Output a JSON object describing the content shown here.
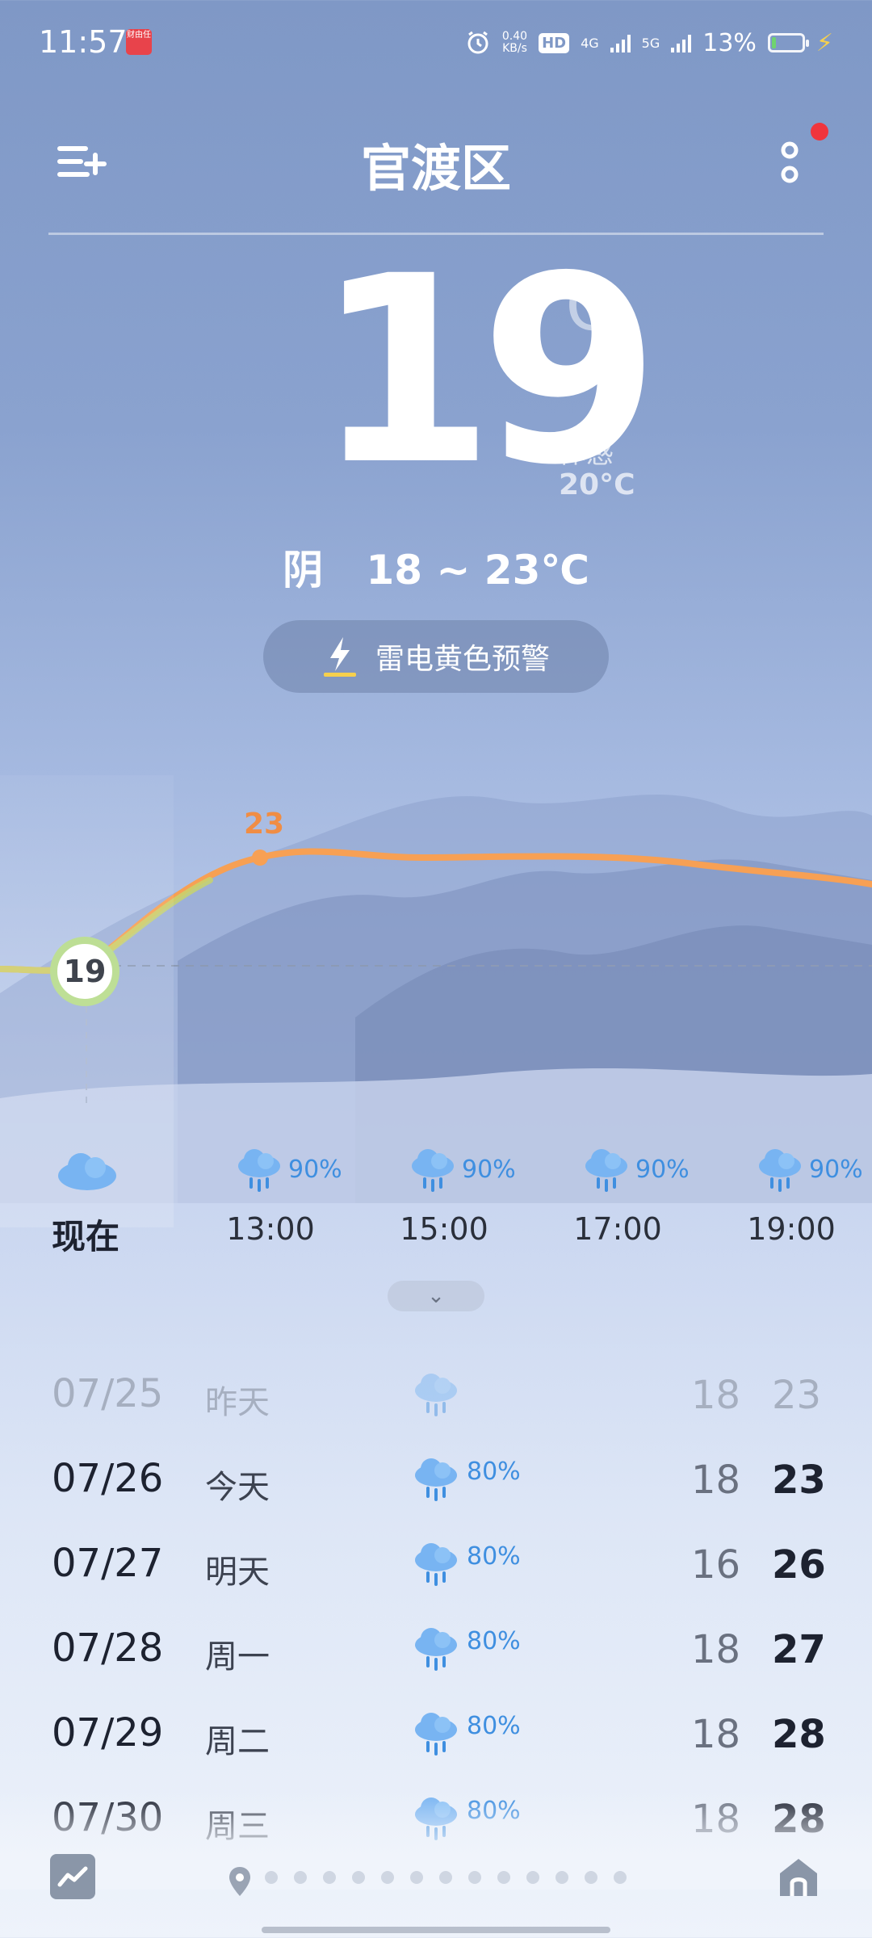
{
  "status_bar": {
    "time": "11:57",
    "app_badge": "财由任",
    "net_speed_value": "0.40",
    "net_speed_unit": "KB/s",
    "hd": "HD",
    "network_4g": "4G",
    "network_5g": "5G",
    "battery_percent": "13%",
    "battery_level": 0.13
  },
  "header": {
    "city": "官渡区",
    "menu_icon": "menu-add-icon",
    "more_icon": "more-icon"
  },
  "current": {
    "temperature": "19",
    "unit": "℃",
    "feels_like_label": "体感",
    "feels_like_value": "20°C",
    "condition": "阴",
    "range": "18 ~ 23℃",
    "warning": "雷电黄色预警"
  },
  "hourly": {
    "now_label": "现在",
    "now_temp": "19",
    "peak_temp": "23",
    "items": [
      {
        "time": "13:00",
        "precip": "90%"
      },
      {
        "time": "15:00",
        "precip": "90%"
      },
      {
        "time": "17:00",
        "precip": "90%"
      },
      {
        "time": "19:00",
        "precip": "90%"
      }
    ]
  },
  "daily": [
    {
      "date": "07/25",
      "day": "昨天",
      "precip": "",
      "low": "18",
      "high": "23"
    },
    {
      "date": "07/26",
      "day": "今天",
      "precip": "80%",
      "low": "18",
      "high": "23"
    },
    {
      "date": "07/27",
      "day": "明天",
      "precip": "80%",
      "low": "16",
      "high": "26"
    },
    {
      "date": "07/28",
      "day": "周一",
      "precip": "80%",
      "low": "18",
      "high": "27"
    },
    {
      "date": "07/29",
      "day": "周二",
      "precip": "80%",
      "low": "18",
      "high": "28"
    },
    {
      "date": "07/30",
      "day": "周三",
      "precip": "80%",
      "low": "18",
      "high": "28"
    }
  ],
  "bottom_nav": {
    "trend_icon": "trend-chart-icon",
    "location_icon": "location-pin-icon",
    "page_dot_count": 13,
    "home_icon": "home-icon"
  },
  "colors": {
    "accent_blue": "#3f8fe0",
    "curve_orange": "#f7a054",
    "curve_green": "#a8d57a",
    "warning_yellow": "#f6d04d"
  }
}
